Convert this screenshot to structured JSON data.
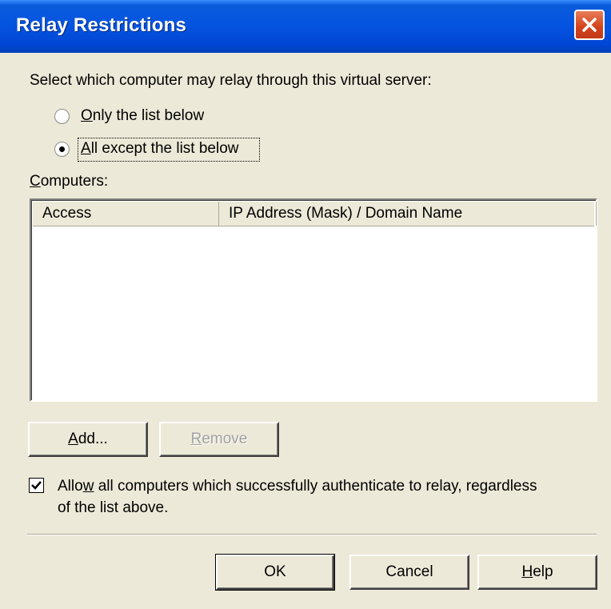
{
  "window": {
    "title": "Relay Restrictions"
  },
  "prompt": "Select which computer may relay through this virtual server:",
  "radio_options": [
    {
      "label_accel": "O",
      "label_rest": "nly the list below",
      "selected": false
    },
    {
      "label_accel": "A",
      "label_rest": "ll except the list below",
      "selected": true
    }
  ],
  "computers": {
    "label_accel": "C",
    "label_rest": "omputers:",
    "columns": [
      "Access",
      "IP Address (Mask) / Domain Name"
    ],
    "rows": []
  },
  "buttons": {
    "add": {
      "accel": "A",
      "rest": "dd..."
    },
    "remove": {
      "accel": "R",
      "rest": "emove"
    },
    "ok": "OK",
    "cancel": "Cancel",
    "help": {
      "accel": "H",
      "rest": "elp"
    }
  },
  "allow_auth": {
    "checked": true,
    "line1_pre": "Allo",
    "line1_accel": "w",
    "line1_post": " all computers which successfully authenticate to relay, regardless",
    "line2": "of the list above."
  },
  "colors": {
    "titlebar": "#0553e0",
    "dialog_bg": "#ece9d8",
    "close_button": "#d3431a"
  }
}
